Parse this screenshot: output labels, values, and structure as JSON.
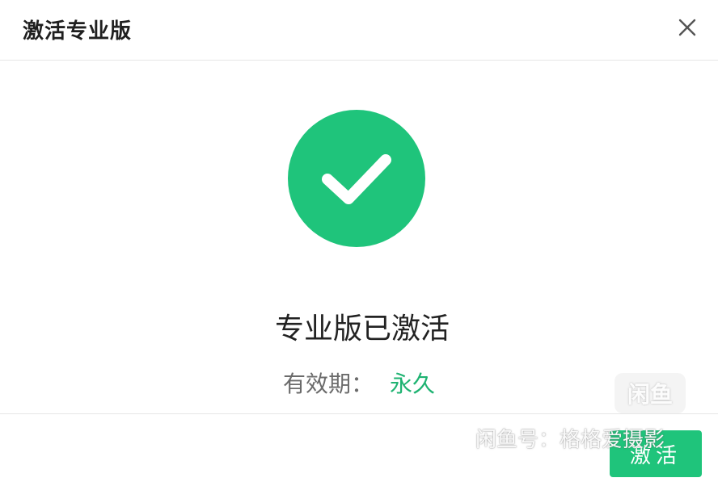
{
  "dialog": {
    "title": "激活专业版",
    "close_icon": "close-icon"
  },
  "status": {
    "icon": "check-circle-icon",
    "message": "专业版已激活",
    "validity_label": "有效期：",
    "validity_value": "永久"
  },
  "footer": {
    "activate_label": "激活"
  },
  "watermark": {
    "logo_text": "闲鱼",
    "text": "闲鱼号：格格爱摄影"
  },
  "colors": {
    "accent": "#1fc47b",
    "validity_value": "#1fb372"
  }
}
